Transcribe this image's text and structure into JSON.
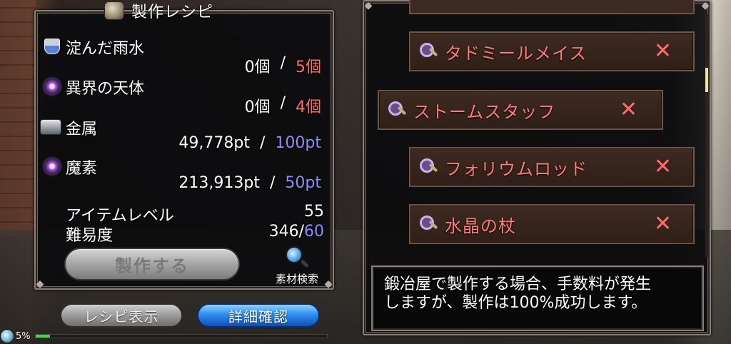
{
  "title": "製作レシピ",
  "materials": [
    {
      "name": "淀んだ雨水",
      "icon": "flask-icon",
      "have": "0個",
      "need": "5個"
    },
    {
      "name": "異界の天体",
      "icon": "orb-icon",
      "have": "0個",
      "need": "4個"
    },
    {
      "name": "金属",
      "icon": "metal-icon",
      "have": "49,778pt",
      "need": "100pt"
    },
    {
      "name": "魔素",
      "icon": "orb-icon",
      "have": "213,913pt",
      "need": "50pt"
    }
  ],
  "separator": "/",
  "item_level": {
    "label": "アイテムレベル",
    "value": "55"
  },
  "difficulty": {
    "label": "難易度",
    "value": "346",
    "sep": "/",
    "max": "60"
  },
  "buttons": {
    "craft": "製作する",
    "material_search": "素材検索",
    "recipe_display": "レシピ表示",
    "details": "詳細確認"
  },
  "status": {
    "percent_text": "5%",
    "progress": 0.05
  },
  "recipes": [
    {
      "name": "タドミールメイス",
      "mark": "✕"
    },
    {
      "name": "ストームスタッフ",
      "mark": "✕"
    },
    {
      "name": "フォリウムロッド",
      "mark": "✕"
    },
    {
      "name": "水晶の杖",
      "mark": "✕"
    }
  ],
  "message": {
    "line1": "鍛冶屋で製作する場合、手数料が発生",
    "line2": "しますが、製作は100%成功します。"
  },
  "colors": {
    "required_insufficient": "#ff6b6b",
    "required_sufficient": "#8f8cff",
    "recipe_text": "#ff7a7a",
    "detail_button": "#2f8ff0"
  }
}
